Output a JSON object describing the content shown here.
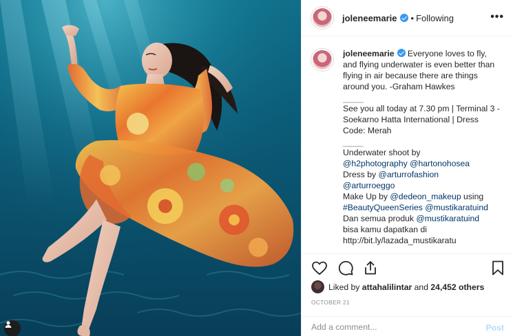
{
  "post": {
    "username": "joleneemarie",
    "follow_status": "Following",
    "separator": "•",
    "more_label": "•••"
  },
  "caption": {
    "username": "joleneemarie",
    "quote": "Everyone loves to fly, and flying underwater is even better than flying in air because there are things around you. -Graham Hawkes",
    "sep1": "_____",
    "event": "See you all today at 7.30 pm | Terminal 3 - Soekarno Hatta International | Dress Code: Merah",
    "sep2": "_____",
    "credit1": "Underwater shoot by",
    "mention_h2": "@h2photography",
    "mention_harton": "@hartonohosea",
    "dress_by": "Dress by",
    "mention_arturro": "@arturrofashion",
    "mention_arturroeggo": "@arturroeggo",
    "makeup_by": "Make Up by",
    "mention_dedeon": "@dedeon_makeup",
    "using": "using",
    "hashtag": "#BeautyQueenSeries",
    "mention_mustika": "@mustikaratuind",
    "dan_semua": "Dan semua produk",
    "mention_mustika2": "@mustikaratuind",
    "bisa": "bisa kamu dapatkan di",
    "link": "http://bit.ly/lazada_mustikaratu",
    "sep3": "_____"
  },
  "likes": {
    "prefix": "Liked by",
    "user": "attahalilintar",
    "and": "and",
    "count": "24,452 others"
  },
  "date": "OCTOBER 21",
  "comment": {
    "placeholder": "Add a comment...",
    "post_label": "Post"
  },
  "icons": {
    "like": "heart-icon",
    "comment": "comment-icon",
    "share": "share-icon",
    "save": "bookmark-icon",
    "verified": "verified-badge-icon",
    "more": "more-options-icon"
  },
  "colors": {
    "link": "#003569",
    "verified": "#3897f0",
    "post_disabled": "#b3dbff",
    "water": "#0b5c78"
  }
}
